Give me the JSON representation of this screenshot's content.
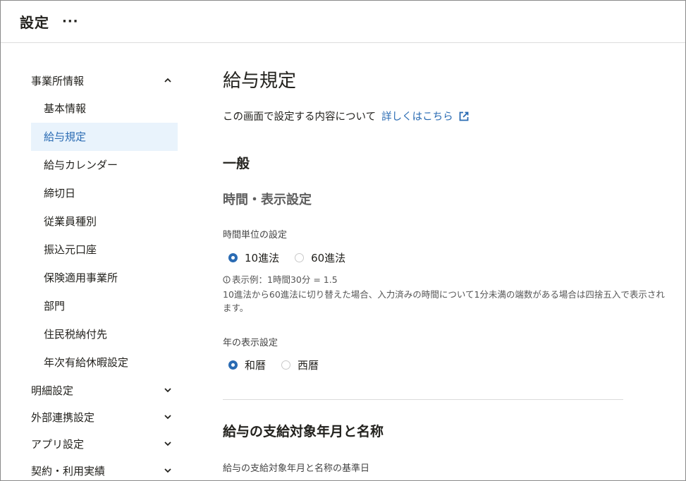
{
  "header": {
    "title": "設定",
    "more": "···"
  },
  "sidebar": {
    "group_office": "事業所情報",
    "items": [
      "基本情報",
      "給与規定",
      "給与カレンダー",
      "締切日",
      "従業員種別",
      "振込元口座",
      "保険適用事業所",
      "部門",
      "住民税納付先",
      "年次有給休暇設定"
    ],
    "active_index": 1,
    "groups": [
      "明細設定",
      "外部連携設定",
      "アプリ設定",
      "契約・利用実績"
    ]
  },
  "main": {
    "title": "給与規定",
    "intro_text": "この画面で設定する内容について",
    "intro_link": "詳しくはこちら",
    "section_general": "一般",
    "sub_time": "時間・表示設定",
    "time_unit": {
      "label": "時間単位の設定",
      "options": [
        "10進法",
        "60進法"
      ],
      "selected": "10進法",
      "example": "表示例：1時間30分 = 1.5",
      "note": "10進法から60進法に切り替えた場合、入力済みの時間について1分未満の端数がある場合は四捨五入で表示されます。"
    },
    "year_display": {
      "label": "年の表示設定",
      "options": [
        "和暦",
        "西暦"
      ],
      "selected": "和暦"
    },
    "section_pay": "給与の支給対象年月と名称",
    "pay_basis_label": "給与の支給対象年月と名称の基準日"
  },
  "colors": {
    "accent": "#2a6bb3",
    "active_bg": "#e9f3fc"
  },
  "icons": [
    "more-icon",
    "chevron-up-icon",
    "chevron-down-icon",
    "external-link-icon",
    "info-icon"
  ]
}
